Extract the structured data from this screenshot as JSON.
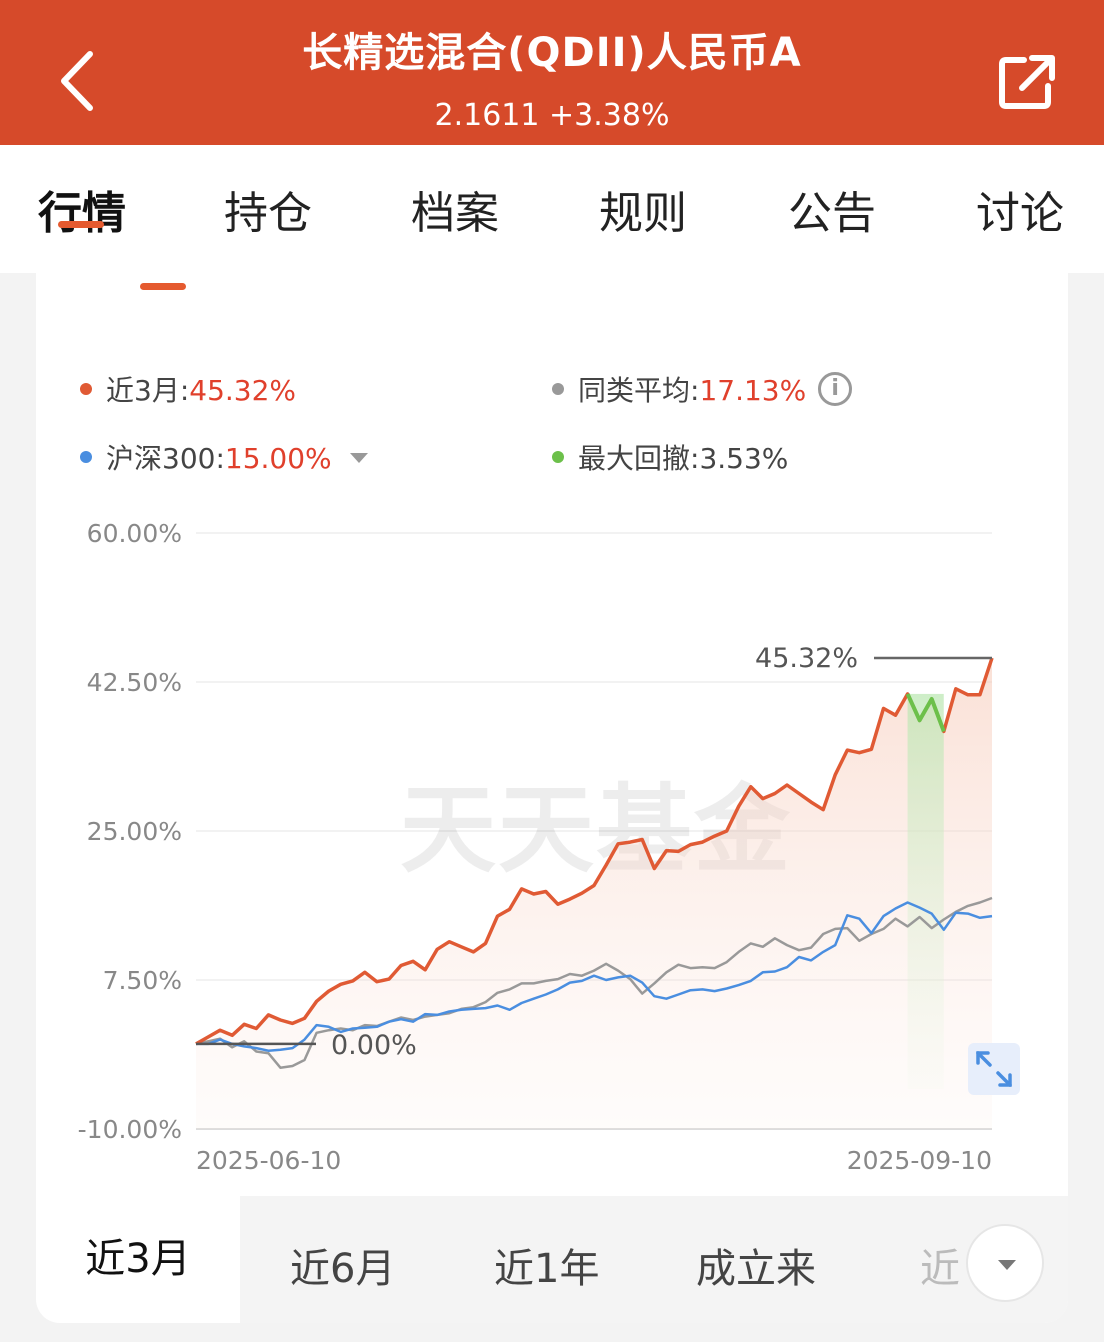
{
  "header": {
    "title": "长精选混合(QDII)人民币A",
    "price": "2.1611",
    "change": "+3.38%",
    "back_icon": "chevron-left-icon",
    "share_icon": "share-icon",
    "bg_color": "#d64a2a"
  },
  "tabs": [
    {
      "label": "行情",
      "active": true
    },
    {
      "label": "持仓"
    },
    {
      "label": "档案"
    },
    {
      "label": "规则"
    },
    {
      "label": "公告"
    },
    {
      "label": "讨论"
    }
  ],
  "legend": {
    "fund": {
      "label": "近3月:",
      "value": "45.32%",
      "color": "#e05a34"
    },
    "peer": {
      "label": "同类平均:",
      "value": "17.13%",
      "color": "#999999"
    },
    "index": {
      "label": "沪深300:",
      "value": "15.00%",
      "color": "#4a8ee0"
    },
    "drawdown": {
      "label": "最大回撤:",
      "value": "3.53%",
      "color": "#6cc04a"
    }
  },
  "chart_data": {
    "type": "line",
    "watermark": "天天基金",
    "y_ticks": [
      "60.00%",
      "42.50%",
      "25.00%",
      "7.50%",
      "-10.00%"
    ],
    "ylim": [
      -10,
      60
    ],
    "x_labels": [
      "2025-06-10",
      "2025-09-10"
    ],
    "annotations": {
      "end": "45.32%",
      "start": "0.00%"
    },
    "series": [
      {
        "name": "近3月",
        "color": "#e05a34",
        "values": [
          0,
          0.8,
          1.6,
          1.0,
          2.3,
          1.8,
          3.4,
          2.8,
          2.4,
          3.0,
          5.0,
          6.2,
          7.0,
          7.4,
          8.4,
          7.3,
          7.6,
          9.2,
          9.7,
          8.7,
          11.1,
          12.0,
          11.4,
          10.8,
          11.8,
          15.0,
          15.8,
          18.2,
          17.6,
          17.9,
          16.4,
          17.0,
          17.7,
          18.6,
          21.0,
          23.5,
          23.7,
          24.0,
          20.6,
          22.7,
          22.6,
          23.4,
          23.7,
          24.4,
          25.0,
          27.9,
          30.2,
          28.8,
          29.4,
          30.4,
          29.4,
          28.4,
          27.5,
          31.6,
          34.5,
          34.2,
          34.6,
          39.4,
          38.6,
          41.1,
          38.0,
          40.5,
          36.7,
          41.7,
          41.0,
          41.0,
          45.32
        ]
      },
      {
        "name": "沪深300",
        "color": "#4a8ee0",
        "values": [
          0,
          0,
          0.5,
          0,
          -0.3,
          -0.5,
          -0.8,
          -0.7,
          -0.5,
          0.5,
          2.2,
          2.0,
          1.4,
          1.8,
          1.9,
          2.0,
          2.6,
          2.9,
          2.6,
          3.5,
          3.4,
          3.8,
          4.0,
          4.1,
          4.2,
          4.5,
          4.0,
          4.8,
          5.3,
          5.8,
          6.4,
          7.2,
          7.4,
          8.0,
          7.5,
          7.8,
          8.0,
          7.2,
          5.6,
          5.3,
          5.8,
          6.3,
          6.4,
          6.2,
          6.5,
          6.9,
          7.4,
          8.4,
          8.5,
          9.0,
          10.2,
          9.8,
          10.8,
          11.6,
          15.1,
          14.7,
          13.0,
          15.0,
          15.9,
          16.6,
          16.0,
          15.3,
          13.4,
          15.4,
          15.3,
          14.8,
          15.0
        ]
      },
      {
        "name": "同类平均",
        "color": "#999999",
        "values": [
          0,
          0.3,
          0.6,
          -0.4,
          0.3,
          -0.9,
          -1.1,
          -2.8,
          -2.6,
          -1.9,
          1.3,
          1.6,
          1.8,
          1.6,
          2.2,
          2.1,
          2.6,
          3.1,
          2.8,
          3.2,
          3.4,
          3.6,
          4.1,
          4.3,
          4.9,
          6.0,
          6.4,
          7.1,
          7.1,
          7.4,
          7.6,
          8.2,
          8.0,
          8.6,
          9.4,
          8.6,
          7.6,
          5.9,
          7.1,
          8.4,
          9.3,
          8.9,
          9.0,
          8.9,
          9.6,
          10.8,
          11.8,
          11.4,
          12.4,
          11.6,
          11.0,
          11.3,
          12.9,
          13.5,
          13.6,
          12.1,
          12.9,
          13.5,
          14.7,
          13.8,
          14.9,
          13.6,
          14.6,
          15.5,
          16.2,
          16.6,
          17.13
        ]
      }
    ],
    "drawdown": {
      "start_index": 59,
      "end_index": 62,
      "color": "#6cc04a"
    },
    "grid": true
  },
  "periods": [
    {
      "label": "近3月",
      "active": true
    },
    {
      "label": "近6月"
    },
    {
      "label": "近1年"
    },
    {
      "label": "成立来"
    },
    {
      "label": "近"
    }
  ],
  "icons": {
    "expand": "expand-icon",
    "more": "chevron-down-icon",
    "info": "info-icon"
  }
}
